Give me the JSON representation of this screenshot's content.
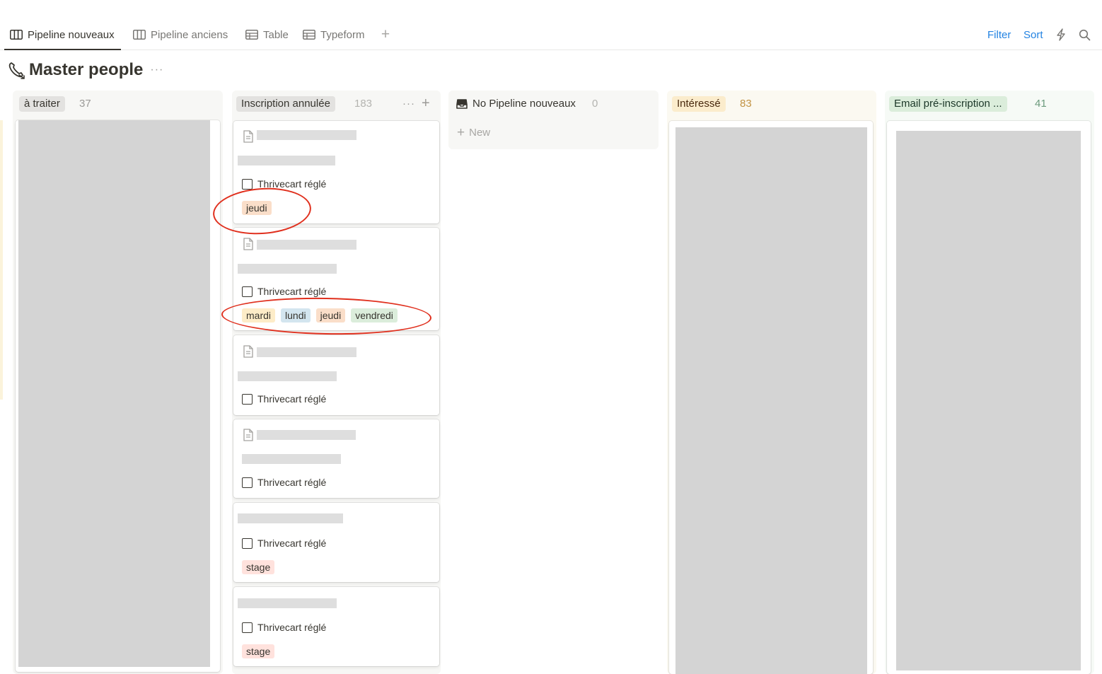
{
  "tabs": [
    {
      "label": "Pipeline nouveaux",
      "icon": "board-icon",
      "active": true
    },
    {
      "label": "Pipeline anciens",
      "icon": "board-icon",
      "active": false
    },
    {
      "label": "Table",
      "icon": "table-icon",
      "active": false
    },
    {
      "label": "Typeform",
      "icon": "table-icon",
      "active": false
    }
  ],
  "toolbar": {
    "filter_label": "Filter",
    "sort_label": "Sort",
    "automation_icon": "lightning-icon",
    "search_icon": "search-icon"
  },
  "page": {
    "title": "Master people",
    "icon": "telephone-icon"
  },
  "columns": {
    "a_traiter": {
      "name": "à traiter",
      "count": "37",
      "color": "#e3e2e0"
    },
    "inscription_annulee": {
      "name": "Inscription annulée",
      "count": "183",
      "color": "#e3e2e0",
      "cards": [
        {
          "checkbox_label": "Thrivecart réglé",
          "checked": false,
          "tags": [
            "jeudi"
          ]
        },
        {
          "checkbox_label": "Thrivecart réglé",
          "checked": false,
          "tags": [
            "mardi",
            "lundi",
            "jeudi",
            "vendredi"
          ]
        },
        {
          "checkbox_label": "Thrivecart réglé",
          "checked": false,
          "tags": []
        },
        {
          "checkbox_label": "Thrivecart réglé",
          "checked": false,
          "tags": []
        },
        {
          "checkbox_label": "Thrivecart réglé",
          "checked": false,
          "tags": [
            "stage"
          ]
        },
        {
          "checkbox_label": "Thrivecart réglé",
          "checked": false,
          "tags": [
            "stage"
          ]
        }
      ]
    },
    "no_pipeline": {
      "name": "No Pipeline nouveaux",
      "count": "0",
      "new_label": "New"
    },
    "interesse": {
      "name": "Intéressé",
      "count": "83",
      "color": "#fbeccc"
    },
    "email_pre_inscription": {
      "name": "Email pré-inscription ...",
      "count": "41",
      "color": "#dbeddb"
    }
  },
  "tag_colors": {
    "lundi": "#d3e5ef",
    "mardi": "#fdecc8",
    "jeudi": "#fadec9",
    "vendredi": "#dbeddb",
    "stage": "#ffe2dd"
  },
  "annotation_color": "#e0301e"
}
